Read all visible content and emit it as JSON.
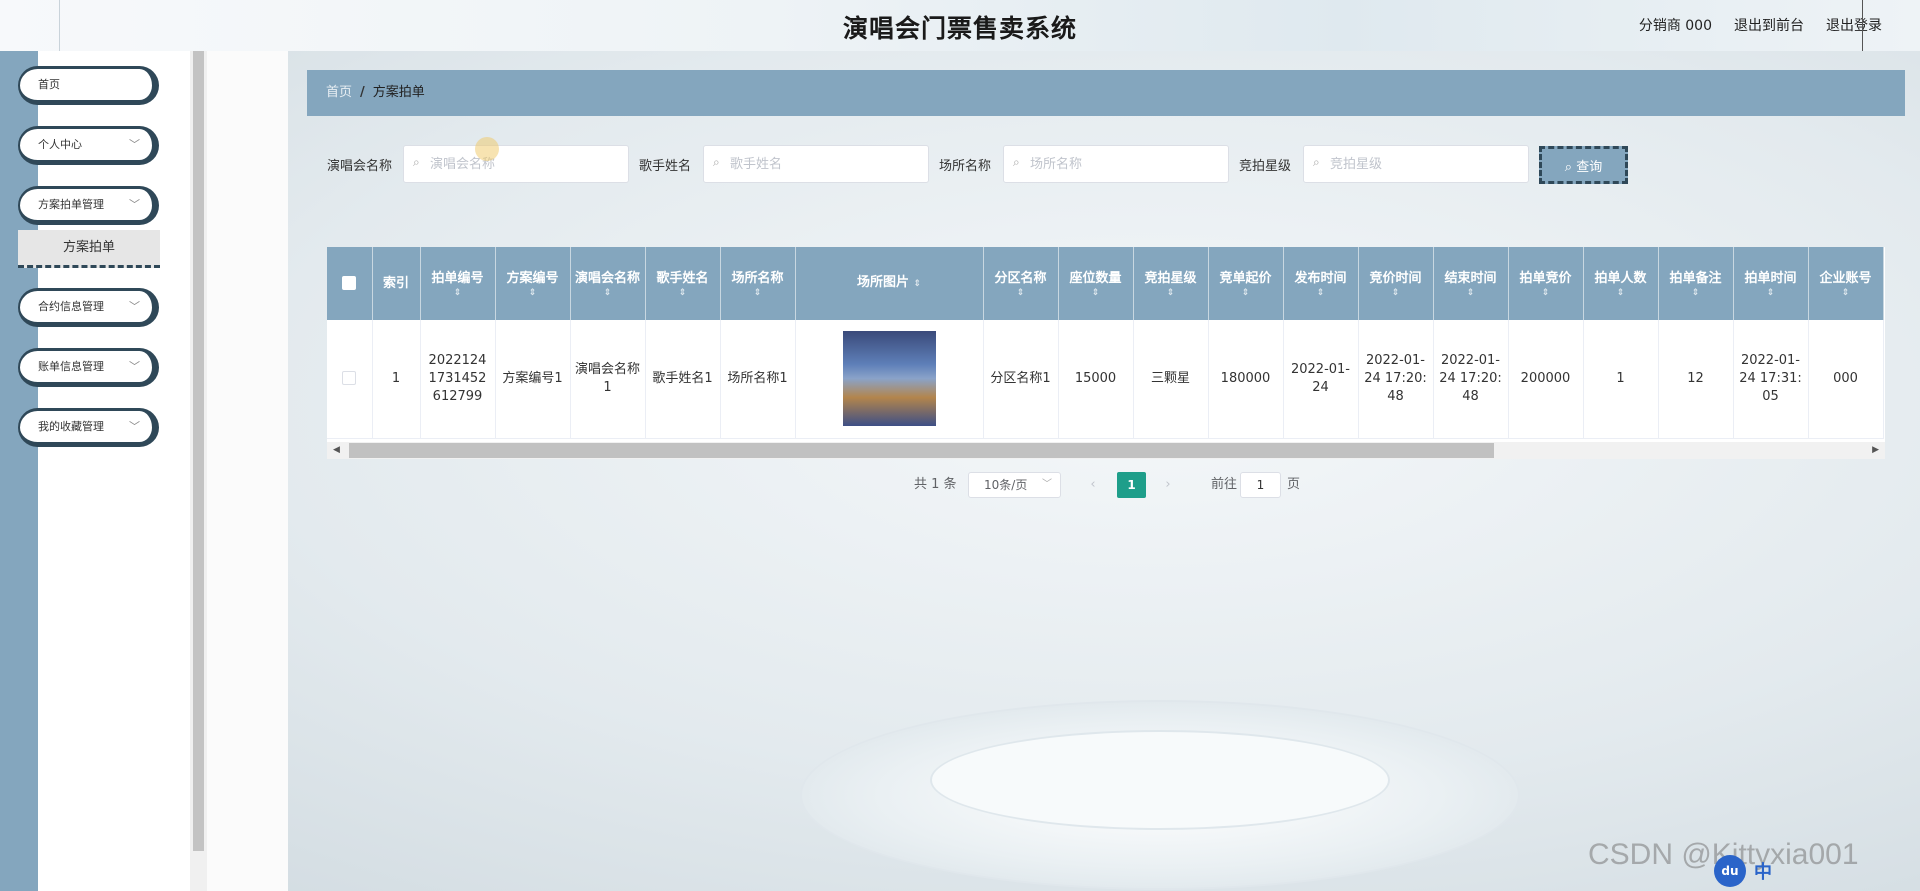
{
  "header": {
    "title": "演唱会门票售卖系统",
    "user_label": "分销商 000",
    "back_front_label": "退出到前台",
    "logout_label": "退出登录"
  },
  "sidebar": {
    "items": [
      {
        "label": "首页",
        "has_chevron": false
      },
      {
        "label": "个人中心",
        "has_chevron": true
      },
      {
        "label": "方案拍单管理",
        "has_chevron": true
      },
      {
        "label": "合约信息管理",
        "has_chevron": true
      },
      {
        "label": "账单信息管理",
        "has_chevron": true
      },
      {
        "label": "我的收藏管理",
        "has_chevron": true
      }
    ],
    "submenu_active": "方案拍单"
  },
  "breadcrumb": {
    "home": "首页",
    "separator": "/",
    "current": "方案拍单"
  },
  "search": {
    "concert_label": "演唱会名称",
    "concert_placeholder": "演唱会名称",
    "singer_label": "歌手姓名",
    "singer_placeholder": "歌手姓名",
    "venue_label": "场所名称",
    "venue_placeholder": "场所名称",
    "level_label": "竞拍星级",
    "level_placeholder": "竞拍星级",
    "button_label": "查询"
  },
  "table": {
    "columns": [
      "索引",
      "拍单编号",
      "方案编号",
      "演唱会名称",
      "歌手姓名",
      "场所名称",
      "场所图片",
      "分区名称",
      "座位数量",
      "竞拍星级",
      "竞单起价",
      "发布时间",
      "竞价时间",
      "结束时间",
      "拍单竞价",
      "拍单人数",
      "拍单备注",
      "拍单时间",
      "企业账号"
    ],
    "rows": [
      {
        "index": "1",
        "order_no": "20221241731452612799",
        "plan_no": "方案编号1",
        "concert": "演唱会名称1",
        "singer": "歌手姓名1",
        "venue": "场所名称1",
        "zone": "分区名称1",
        "seats": "15000",
        "level": "三颗星",
        "start_price": "180000",
        "publish_time": "2022-01-24",
        "bid_time": "2022-01-24 17:20:48",
        "end_time": "2022-01-24 17:20:48",
        "bid_price": "200000",
        "bid_count": "1",
        "remark": "12",
        "order_time": "2022-01-24 17:31:05",
        "company": "000"
      }
    ]
  },
  "pagination": {
    "total": "共 1 条",
    "page_size": "10条/页",
    "current_page": "1",
    "goto_label": "前往",
    "goto_value": "1",
    "page_suffix": "页"
  },
  "watermark": "CSDN @Kittyxia001",
  "ime": {
    "icon": "du",
    "lang": "中"
  },
  "colors": {
    "primary": "#84a6be",
    "accent": "#2f4858",
    "page_active": "#1e9e8a"
  }
}
